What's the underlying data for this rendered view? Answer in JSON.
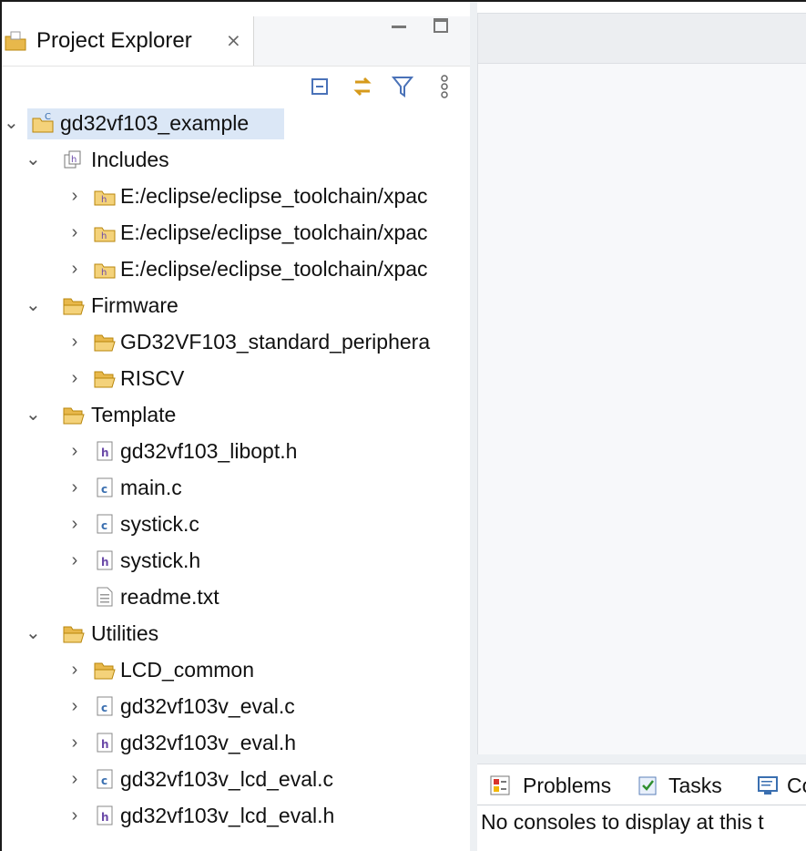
{
  "explorer": {
    "title": "Project Explorer",
    "close_glyph": "⨯",
    "icons": {
      "tab": "project-explorer-icon",
      "collapse_all": "collapse-all-icon",
      "link_with_editor": "link-with-editor-icon",
      "filter": "filter-icon",
      "view_menu": "view-menu-icon",
      "minimize": "minimize-icon",
      "maximize": "maximize-icon"
    }
  },
  "tree": {
    "project": "gd32vf103_example",
    "includes": "Includes",
    "include_paths": [
      "E:/eclipse/eclipse_toolchain/xpac",
      "E:/eclipse/eclipse_toolchain/xpac",
      "E:/eclipse/eclipse_toolchain/xpac"
    ],
    "firmware": "Firmware",
    "firmware_children": [
      "GD32VF103_standard_periphera",
      "RISCV"
    ],
    "template": "Template",
    "template_children": [
      "gd32vf103_libopt.h",
      "main.c",
      "systick.c",
      "systick.h",
      "readme.txt"
    ],
    "utilities": "Utilities",
    "utilities_children": [
      "LCD_common",
      "gd32vf103v_eval.c",
      "gd32vf103v_eval.h",
      "gd32vf103v_lcd_eval.c",
      "gd32vf103v_lcd_eval.h"
    ]
  },
  "bottom_panel": {
    "tabs": [
      "Problems",
      "Tasks",
      "Co"
    ],
    "message": "No consoles to display at this t"
  },
  "colors": {
    "selection": "#dbe7f6",
    "folder": "#e8b84b",
    "source_c": "#3a6fb0",
    "header_h": "#6b4aa8"
  }
}
